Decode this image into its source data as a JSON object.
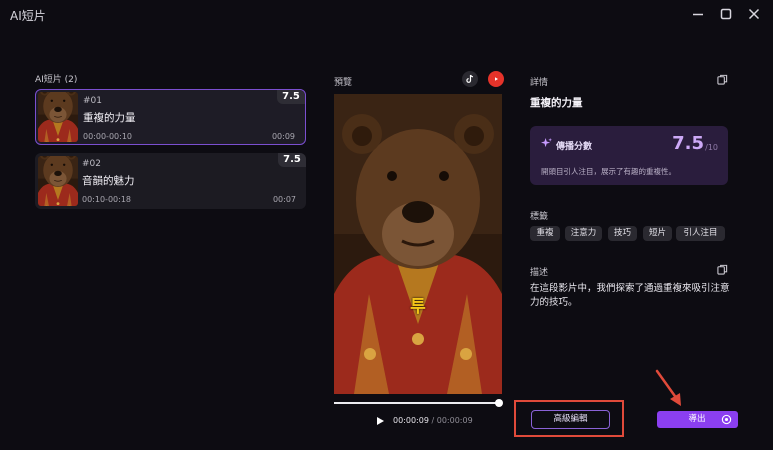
{
  "app": {
    "title": "AI短片"
  },
  "list": {
    "header": "AI短片 (2)",
    "clips": [
      {
        "num": "#01",
        "title": "重複的力量",
        "range": "00:00-00:10",
        "duration": "00:09",
        "score": "7.5",
        "selected": true
      },
      {
        "num": "#02",
        "title": "音韻的魅力",
        "range": "00:10-00:18",
        "duration": "00:07",
        "score": "7.5",
        "selected": false
      }
    ]
  },
  "preview": {
    "label": "預覽",
    "caption": "투",
    "current_time": "00:00:09",
    "separator": "/",
    "total_time": "00:00:09",
    "progress": 1.0
  },
  "details": {
    "label": "詳情",
    "title": "重複的力量",
    "score_label": "傳播分數",
    "score_value": "7.5",
    "score_max": "/10",
    "score_desc": "開頭目引人注目，展示了有趣的重複性。",
    "tags_label": "標籤",
    "tags": [
      "重複",
      "注意力",
      "技巧",
      "短片",
      "引人注目"
    ],
    "desc_label": "描述",
    "description": "在這段影片中，我們探索了通過重複來吸引注意力的技巧。"
  },
  "actions": {
    "advanced_edit": "高級編輯",
    "export": "導出"
  },
  "colors": {
    "accent": "#8b3ff0",
    "highlight": "#e04a3a",
    "selected_border": "#7b4fd0"
  }
}
